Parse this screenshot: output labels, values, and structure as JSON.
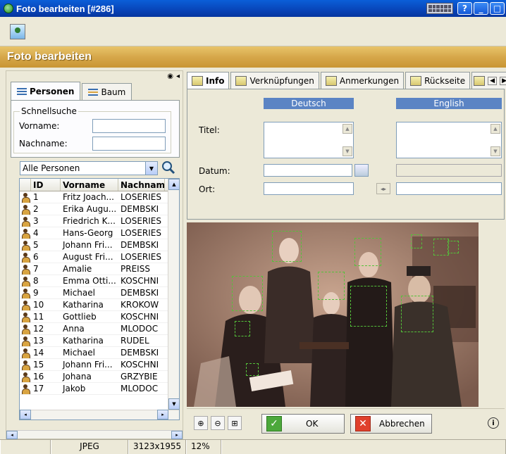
{
  "window": {
    "title": "Foto bearbeiten [#286]"
  },
  "header": {
    "title": "Foto bearbeiten"
  },
  "left": {
    "tabs": [
      {
        "label": "Personen"
      },
      {
        "label": "Baum"
      }
    ],
    "quick_search": {
      "legend": "Schnellsuche",
      "first_name_label": "Vorname:",
      "last_name_label": "Nachname:",
      "first_name_value": "",
      "last_name_value": ""
    },
    "filter": {
      "selected": "Alle Personen"
    },
    "grid": {
      "columns": [
        "",
        "ID",
        "Vorname",
        "Nachname"
      ],
      "rows": [
        {
          "id": "1",
          "first": "Fritz Joach...",
          "last": "LOSERIES"
        },
        {
          "id": "2",
          "first": "Erika Augu...",
          "last": "DEMBSKI"
        },
        {
          "id": "3",
          "first": "Friedrich K...",
          "last": "LOSERIES"
        },
        {
          "id": "4",
          "first": "Hans-Georg",
          "last": "LOSERIES"
        },
        {
          "id": "5",
          "first": "Johann Fri...",
          "last": "DEMBSKI"
        },
        {
          "id": "6",
          "first": "August Fri...",
          "last": "LOSERIES"
        },
        {
          "id": "7",
          "first": "Amalie",
          "last": "PREISS"
        },
        {
          "id": "8",
          "first": "Emma Otti...",
          "last": "KOSCHNI"
        },
        {
          "id": "9",
          "first": "Michael",
          "last": "DEMBSKI"
        },
        {
          "id": "10",
          "first": "Katharina",
          "last": "KROKOW"
        },
        {
          "id": "11",
          "first": "Gottlieb",
          "last": "KOSCHNI"
        },
        {
          "id": "12",
          "first": "Anna",
          "last": "MLODOC"
        },
        {
          "id": "13",
          "first": "Katharina",
          "last": "RUDEL"
        },
        {
          "id": "14",
          "first": "Michael",
          "last": "DEMBSKI"
        },
        {
          "id": "15",
          "first": "Johann Fri...",
          "last": "KOSCHNI"
        },
        {
          "id": "16",
          "first": "Johana",
          "last": "GRZYBIE"
        },
        {
          "id": "17",
          "first": "Jakob",
          "last": "MLODOC"
        }
      ]
    }
  },
  "right": {
    "tabs": [
      {
        "label": "Info"
      },
      {
        "label": "Verknüpfungen"
      },
      {
        "label": "Anmerkungen"
      },
      {
        "label": "Rückseite"
      }
    ],
    "languages": {
      "primary": "Deutsch",
      "secondary": "English"
    },
    "fields": {
      "title_label": "Titel:",
      "date_label": "Datum:",
      "place_label": "Ort:"
    },
    "buttons": {
      "ok": "OK",
      "cancel": "Abbrechen"
    }
  },
  "status": {
    "format": "JPEG",
    "dimensions": "3123x1955",
    "zoom": "12%"
  },
  "colors": {
    "titlebar": "#0a5fd8",
    "header": "#d6a74a",
    "lang_header": "#5b84c4",
    "face_box": "#54c23a"
  }
}
